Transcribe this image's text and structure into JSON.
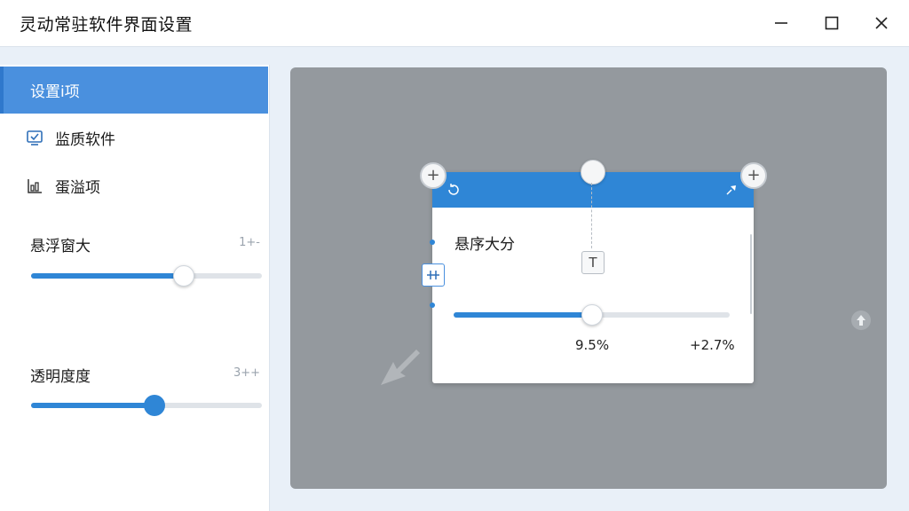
{
  "window": {
    "title": "灵动常驻软件界面设置"
  },
  "sidebar": {
    "items": [
      {
        "label": "设置і项",
        "active": true
      },
      {
        "label": "监质软件",
        "icon": "monitor-check-icon"
      },
      {
        "label": "蛋溢项",
        "icon": "chart-icon"
      }
    ]
  },
  "sliders": {
    "size": {
      "label": "悬浮窗大",
      "value_text": "1+-",
      "fraction": 0.66
    },
    "opacity": {
      "label": "透明度度",
      "value_text": "3++",
      "fraction": 0.535
    }
  },
  "preview": {
    "float_window": {
      "title": "悬序大分",
      "slider_fraction": 0.5,
      "value_left": "9.5%",
      "value_right": "+2.7%"
    },
    "t_handle_label": "T"
  },
  "colors": {
    "accent": "#2f86d6",
    "sidebar_active": "#4a90de",
    "preview_bg": "#94999e"
  }
}
